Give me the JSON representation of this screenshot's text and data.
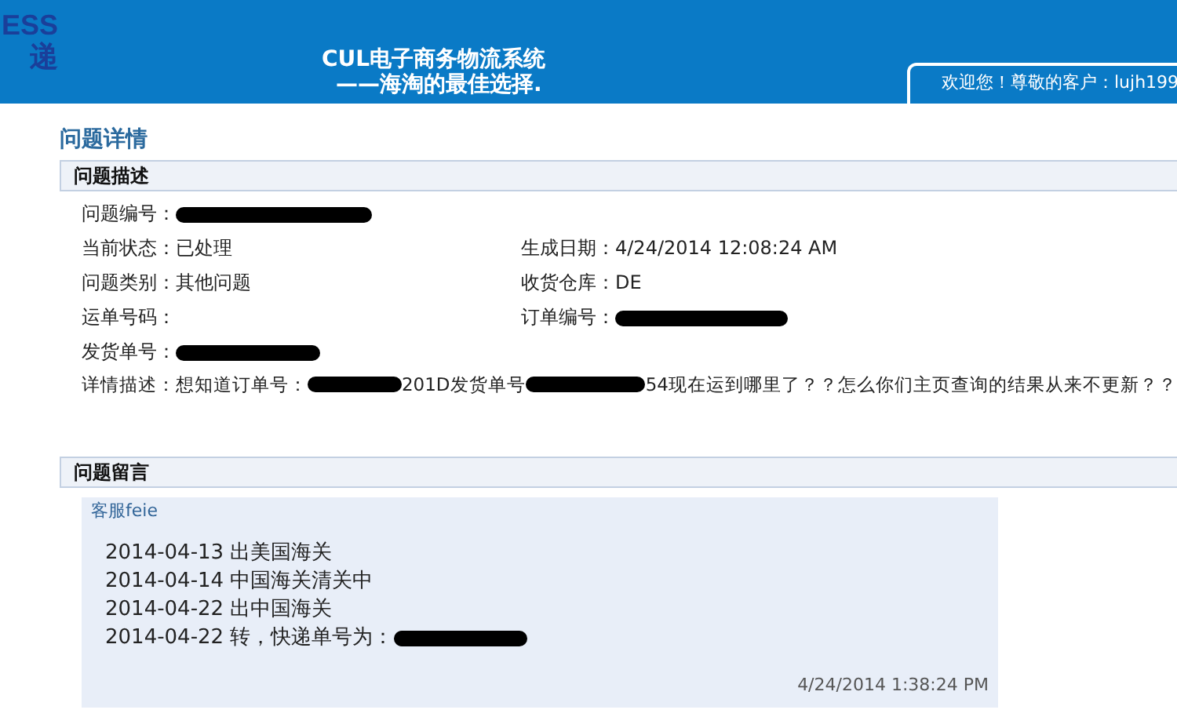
{
  "header": {
    "logo": [
      "ESS",
      "递"
    ],
    "title": "CUL电子商务物流系统",
    "slogan": "——海淘的最佳选择.",
    "welcome": "欢迎您！尊敬的客户：lujh199"
  },
  "page_title": "问题详情",
  "description": {
    "heading": "问题描述",
    "rows": [
      {
        "left": {
          "label": "问题编号：",
          "redacted": true
        }
      },
      {
        "left": {
          "label": "当前状态：",
          "value": "已处理"
        },
        "right": {
          "label": "生成日期：",
          "value": "4/24/2014 12:08:24 AM"
        }
      },
      {
        "left": {
          "label": "问题类别：",
          "value": "其他问题"
        },
        "right": {
          "label": "收货仓库：",
          "value": "DE"
        }
      },
      {
        "left": {
          "label": "运单号码："
        },
        "right": {
          "label": "订单编号：",
          "redacted": true
        }
      },
      {
        "left": {
          "label": "发货单号：",
          "redacted": true
        }
      }
    ],
    "detail": {
      "label": "详情描述：",
      "segments": [
        {
          "kind": "text",
          "text": "想知道订单号："
        },
        {
          "kind": "redacted"
        },
        {
          "kind": "text",
          "text": "201D发货单号"
        },
        {
          "kind": "redacted"
        },
        {
          "kind": "text",
          "text": "54现在运到哪里了？？怎么你们主页查询的结果从来不更新？？"
        }
      ]
    }
  },
  "messages": {
    "heading": "问题留言",
    "items": [
      {
        "author": "客服feie",
        "lines": [
          {
            "text": "2014-04-13 出美国海关",
            "redacted": false
          },
          {
            "text": "2014-04-14 中国海关清关中",
            "redacted": false
          },
          {
            "text": "2014-04-22 出中国海关",
            "redacted": false
          },
          {
            "text": "2014-04-22 转，快递单号为：",
            "redacted": true
          }
        ],
        "time": "4/24/2014 1:38:24 PM"
      }
    ]
  }
}
